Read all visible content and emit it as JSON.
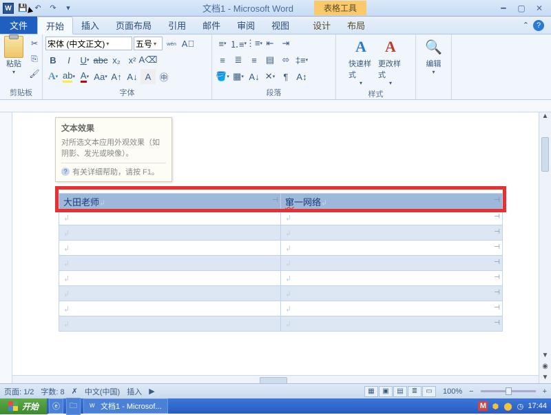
{
  "titlebar": {
    "title": "文档1 - Microsoft Word",
    "context_tab": "表格工具"
  },
  "tabs": {
    "file": "文件",
    "items": [
      "开始",
      "插入",
      "页面布局",
      "引用",
      "邮件",
      "审阅",
      "视图"
    ],
    "context_items": [
      "设计",
      "布局"
    ],
    "active_index": 0
  },
  "ribbon": {
    "clipboard": {
      "label": "剪贴板",
      "paste": "粘贴"
    },
    "font": {
      "label": "字体",
      "font_name": "宋体 (中文正文)",
      "font_size": "五号"
    },
    "paragraph": {
      "label": "段落"
    },
    "styles": {
      "label": "样式",
      "quick": "快速样式",
      "change": "更改样式"
    },
    "editing": {
      "label": "编辑"
    }
  },
  "tooltip": {
    "title": "文本效果",
    "body": "对所选文本应用外观效果（如阴影、发光或映像）。",
    "help": "有关详细帮助，请按 F1。"
  },
  "table": {
    "row1": {
      "col1": "大田老师",
      "col2_a": "窜",
      "col2_b": "一网络"
    }
  },
  "statusbar": {
    "page": "页面: 1/2",
    "words": "字数: 8",
    "lang": "中文(中国)",
    "mode": "插入",
    "zoom": "100%"
  },
  "taskbar": {
    "start": "开始",
    "doc_task": "文档1 - Microsof...",
    "clock": "17:44",
    "ime": "M"
  }
}
